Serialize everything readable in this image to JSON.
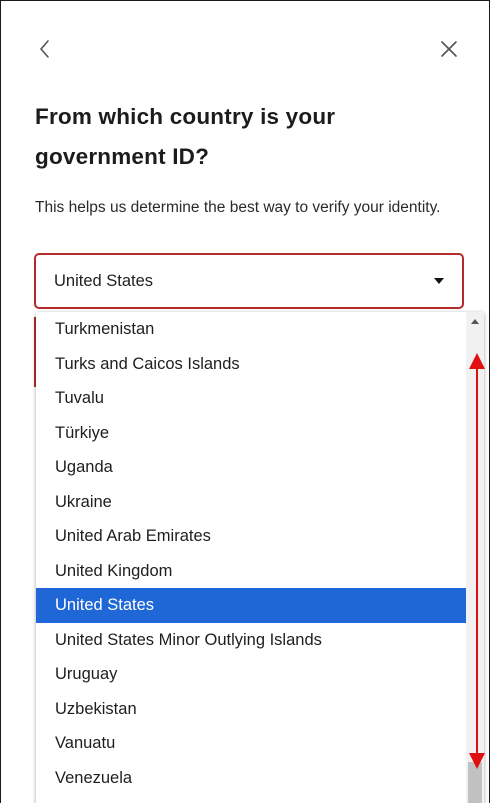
{
  "header": {
    "back_icon": "chevron-left-icon",
    "close_icon": "close-icon"
  },
  "title": "From which country is your government ID?",
  "description": "This helps us determine the best way to verify your identity.",
  "country_select": {
    "value": "United States",
    "icon": "caret-down-icon",
    "border_color": "#b52a2a"
  },
  "dropdown": {
    "options": [
      "Turkmenistan",
      "Turks and Caicos Islands",
      "Tuvalu",
      "Türkiye",
      "Uganda",
      "Ukraine",
      "United Arab Emirates",
      "United Kingdom",
      "United States",
      "United States Minor Outlying Islands",
      "Uruguay",
      "Uzbekistan",
      "Vanuatu",
      "Venezuela"
    ],
    "selected": "United States",
    "selected_color": "#1f67d6"
  },
  "annotation": {
    "icon": "double-headed-arrow-icon",
    "color": "#e01010"
  }
}
